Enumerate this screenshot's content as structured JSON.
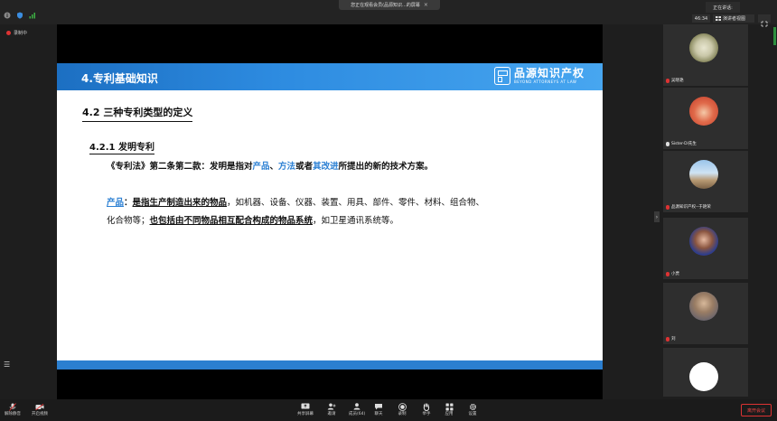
{
  "share_banner": {
    "text": "您正在观看会员(品源知识...的屏幕",
    "close": "×"
  },
  "speaking_label": "正在讲话:",
  "timer": "46:34",
  "view_label": "演讲者视图",
  "recording_label": "录制中",
  "slide": {
    "header_title": "4.专利基础知识",
    "logo_cn": "品源知识产权",
    "logo_en": "BEYOND ATTORNEYS AT LAW",
    "section_title": "4.2 三种专利类型的定义",
    "subsection_title": "4.2.1 发明专利",
    "line1_a": "《专利法》第二条第二款：发明是指对",
    "line1_b": "产品",
    "line1_c": "、",
    "line1_d": "方法",
    "line1_e": "或者",
    "line1_f": "其改进",
    "line1_g": "所提出的新的技术方案。",
    "line2_a": "产品",
    "line2_b": "：",
    "line2_c": "是指生产制造出来的物品",
    "line2_d": "，如机器、设备、仪器、装置、用具、部件、零件、材料、组合物、",
    "line3_a": "化合物等；",
    "line3_b": "也包括由不同物品相互配合构成的物品系统",
    "line3_c": "，如卫星通讯系统等。"
  },
  "participants": [
    {
      "name": "吴晓艳"
    },
    {
      "name": "Sister-Di先生"
    },
    {
      "name": "品源知识产权--于艳荣"
    },
    {
      "name": "小贾"
    },
    {
      "name": "刘"
    },
    {
      "name": ""
    }
  ],
  "toolbar": {
    "mute": "解除静音",
    "video": "开启视频",
    "share": "共享屏幕",
    "invite": "邀请",
    "members": "成员(64)",
    "chat": "聊天",
    "record": "录制",
    "raise_hand": "举手",
    "apps": "应用",
    "settings": "设置",
    "leave": "离开会议"
  },
  "colors": {
    "accent_blue": "#2c80d3",
    "leave_red": "#e44444"
  }
}
